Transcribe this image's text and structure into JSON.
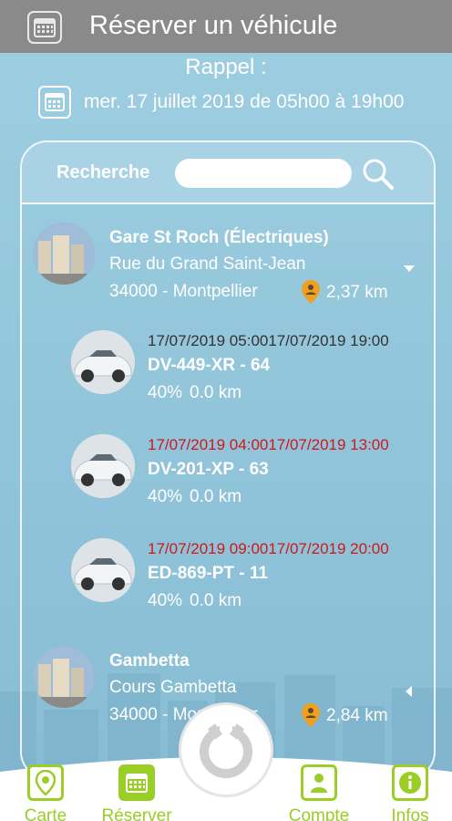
{
  "header": {
    "title": "Réserver un véhicule"
  },
  "reminder": {
    "label": "Rappel :",
    "date_text": "mer. 17 juillet 2019 de 05h00 à 19h00"
  },
  "search": {
    "label": "Recherche",
    "value": "",
    "placeholder": ""
  },
  "stations": [
    {
      "name": "Gare St Roch (Électriques)",
      "street": "Rue du Grand Saint-Jean",
      "city": "34000 - Montpellier",
      "distance": "2,37 km",
      "expanded": true,
      "cars": [
        {
          "range": "17/07/2019 05:0017/07/2019 19:00",
          "status": "available",
          "plate": "DV-449-XR - 64",
          "battery": "40%",
          "mileage": "0.0 km"
        },
        {
          "range": "17/07/2019 04:0017/07/2019 13:00",
          "status": "conflict",
          "plate": "DV-201-XP - 63",
          "battery": "40%",
          "mileage": "0.0 km"
        },
        {
          "range": "17/07/2019 09:0017/07/2019 20:00",
          "status": "conflict",
          "plate": "ED-869-PT - 11",
          "battery": "40%",
          "mileage": "0.0 km"
        }
      ]
    },
    {
      "name": "Gambetta",
      "street": "Cours Gambetta",
      "city": "34000 - Montpellier",
      "distance": "2,84 km",
      "expanded": false,
      "cars": []
    }
  ],
  "nav": {
    "items": [
      {
        "label": "Carte",
        "icon": "map-pin-icon",
        "active": false
      },
      {
        "label": "Réserver",
        "icon": "calendar-icon",
        "active": true
      },
      {
        "label": "Compte",
        "icon": "user-icon",
        "active": false
      },
      {
        "label": "Infos",
        "icon": "info-icon",
        "active": false
      }
    ]
  },
  "colors": {
    "header": "#8a8a8a",
    "background": "#8fc3d9",
    "accent_green": "#9acd25",
    "conflict_red": "#d01818",
    "pin_orange": "#f0a020"
  }
}
